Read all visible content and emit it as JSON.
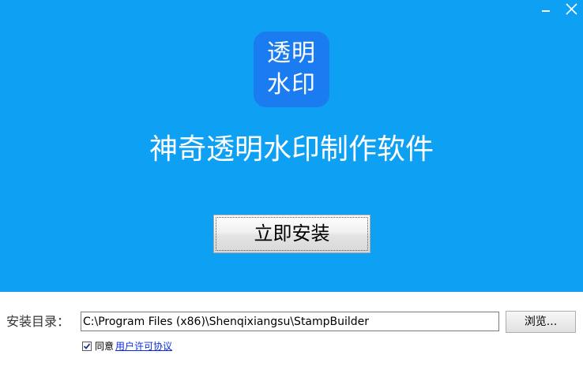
{
  "window": {
    "minimize_icon": "minimize-icon",
    "close_icon": "close-icon"
  },
  "logo": {
    "line1": "透明",
    "line2": "水印"
  },
  "app_title": "神奇透明水印制作软件",
  "install_button": {
    "label": "立即安装"
  },
  "install_dir": {
    "label": "安装目录：",
    "value": "C:\\Program Files (x86)\\Shenqixiangsu\\StampBuilder",
    "browse_label": "浏览..."
  },
  "agreement": {
    "checked": true,
    "prefix": "同意",
    "link_text": "用户许可协议"
  },
  "colors": {
    "header_bg": "#0ea0f3",
    "logo_bg": "#1b7bf0",
    "link": "#0a2ee0"
  }
}
